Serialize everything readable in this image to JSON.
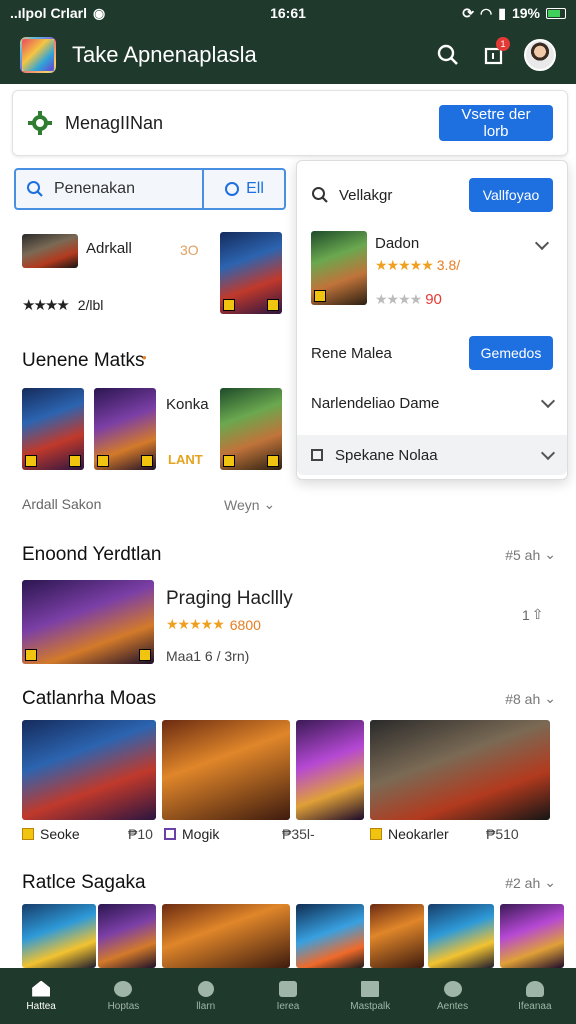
{
  "status_bar": {
    "carrier": "..ılpol Crlarl",
    "time": "16:61",
    "battery": "19%"
  },
  "app_bar": {
    "title": "Take Apnenaplasla",
    "notification_count": "1"
  },
  "manage_card": {
    "title": "MenagIINan",
    "button": "Vsetre der lorb"
  },
  "search": {
    "placeholder": "Penenakan",
    "filter_label": "Ell"
  },
  "game_top": {
    "title": "Adrkall",
    "count": "3O",
    "rating_text": "2/lbl"
  },
  "section_upcoming": {
    "title": "Uenene Matks"
  },
  "upcoming_items": [
    {
      "label": "Konka"
    },
    {
      "label": "LANT"
    }
  ],
  "upcoming_footer": {
    "left": "Ardall Sakon",
    "right": "Weyn"
  },
  "section_featured": {
    "title": "Enoond Yerdtlan",
    "meta": "#5 ah"
  },
  "featured_game": {
    "title": "Praging Hacllly",
    "rating": "6800",
    "subtitle": "Maa1 6 / 3rn)",
    "count": "1"
  },
  "section_category": {
    "title": "Catlanrha Moas",
    "meta": "#8 ah"
  },
  "category_items": [
    {
      "label": "Seoke",
      "price": "₱10"
    },
    {
      "label": "Mogik",
      "price": "₱35l-"
    },
    {
      "label": "Neokarler",
      "price": "₱510"
    }
  ],
  "section_battle": {
    "title": "Ratlce Sagaka",
    "meta": "#2 ah"
  },
  "panel": {
    "search_text": "Vellakgr",
    "search_button": "Vallfoyao",
    "game_title": "Dadon",
    "game_rating": "3.8/",
    "game_price": "90",
    "row1_label": "Rene Malea",
    "row1_button": "Gemedos",
    "row2_label": "Narlendeliao Dame",
    "row3_label": "Spekane Nolaa"
  },
  "bottom_nav": [
    {
      "label": "Hattea",
      "icon": "home-icon"
    },
    {
      "label": "Hoptas",
      "icon": "shield-icon"
    },
    {
      "label": "llarn",
      "icon": "search-icon"
    },
    {
      "label": "Ierea",
      "icon": "lock-icon"
    },
    {
      "label": "Mastpalk",
      "icon": "book-icon"
    },
    {
      "label": "Aentes",
      "icon": "gift-icon"
    },
    {
      "label": "Ifeanaa",
      "icon": "person-icon"
    }
  ],
  "colors": {
    "bar": "#1f3a2c",
    "accent": "#1e6fe0",
    "star": "#f0a020"
  }
}
